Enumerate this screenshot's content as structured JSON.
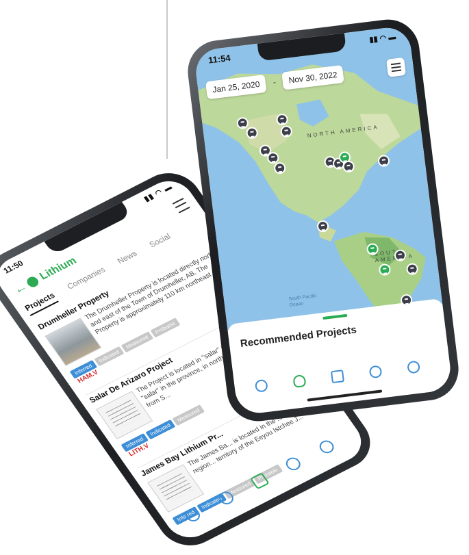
{
  "back_phone": {
    "time": "11:50",
    "app_title": "Lithium",
    "tabs": [
      "Projects",
      "Companies",
      "News",
      "Social"
    ],
    "active_tab": "Projects",
    "projects": [
      {
        "title": "Drumheller Property",
        "description": "The Drumheller Property is located directly north and east of the Town of Drumheller, AB. The Property is approximately 110 km northeast of...",
        "tags": [
          "Inferred",
          "Indicated",
          "Measured",
          "Probable"
        ],
        "ticker": "HAM.V"
      },
      {
        "title": "Salar De Arizaro Project",
        "description": "The Project is located in \"salar\" in the salt lake, or \"salar\" in the province, in northwest about 170 km from S...",
        "tags": [
          "Inferred",
          "Indicated",
          "Measured"
        ],
        "ticker": "LITH.V"
      },
      {
        "title": "James Bay Lithium Pr...",
        "description": "The James Ba... is located in the ... administrative region... territory of the Eeyou Istchee J...",
        "tags": [
          "Inferred",
          "Indicated",
          "Measured",
          "Probable"
        ],
        "ticker": ""
      }
    ],
    "nav_icons": [
      "dashboard-icon",
      "lightbulb-icon",
      "document-search-icon",
      "news-icon",
      "profile-icon"
    ]
  },
  "front_phone": {
    "time": "11:54",
    "date_start": "Jan 25, 2020",
    "date_end": "Nov 30, 2022",
    "date_separator": "-",
    "map_labels": {
      "north_america": "NORTH AMERICA",
      "south_america": "SOUTH AMERICA",
      "ocean": "South Pacific Ocean"
    },
    "sheet_title": "Recommended Projects",
    "nav_icons": [
      "dashboard-icon",
      "lightbulb-icon",
      "document-search-icon",
      "news-icon",
      "profile-icon"
    ],
    "colors": {
      "accent": "#2bab54",
      "link": "#3d8ed6",
      "pin": "#3c3f4a",
      "ocean": "#8fc2e8",
      "land": "#bcd89a"
    }
  }
}
